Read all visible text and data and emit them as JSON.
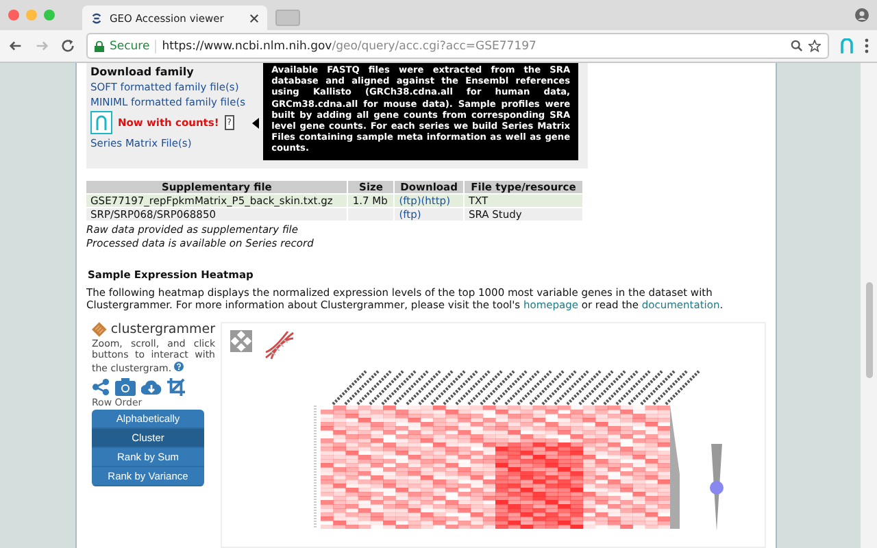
{
  "browser": {
    "tabs": [
      {
        "title": "GEO Accession viewer",
        "selected": true
      }
    ],
    "security": "Secure",
    "url_host": "https://www.ncbi.nlm.nih.gov",
    "url_path": "/geo/query/acc.cgi?acc=GSE77197"
  },
  "download_family": {
    "heading": "Download family",
    "links": [
      "SOFT formatted family file(s)",
      "MINIML formatted family file(s"
    ],
    "badge": "Now with counts!",
    "help": "?",
    "series_matrix": "Series Matrix File(s)",
    "tooltip": "Available FASTQ files were extracted from the SRA database and aligned against the Ensembl references using Kallisto (GRCh38.cdna.all for human data, GRCm38.cdna.all for mouse data). Sample profiles were built by adding all gene counts from corresponding SRA level gene counts. For each series we build Series Matrix Files containing sample meta information as well as gene counts."
  },
  "supplementary": {
    "columns": [
      "Supplementary file",
      "Size",
      "Download",
      "File type/resource"
    ],
    "rows": [
      {
        "file": "GSE77197_repFpkmMatrix_P5_back_skin.txt.gz",
        "size": "1.7 Mb",
        "downloads": [
          "(ftp)",
          "(http)"
        ],
        "type": "TXT"
      },
      {
        "file": "SRP/SRP068/SRP068850",
        "size": "",
        "downloads": [
          "(ftp)"
        ],
        "type": "SRA Study"
      }
    ],
    "notes": [
      "Raw data provided as supplementary file",
      "Processed data is available on Series record"
    ]
  },
  "heatmap_section": {
    "heading": "Sample Expression Heatmap",
    "paragraph": [
      {
        "kind": "text",
        "text": "The following heatmap displays the normalized expression levels of the top 1000 most variable genes in the dataset with Clustergrammer. For more information about Clustergrammer, please visit the tool's "
      },
      {
        "kind": "link",
        "text": "homepage"
      },
      {
        "kind": "text",
        "text": " or read the "
      },
      {
        "kind": "link",
        "text": "documentation"
      },
      {
        "kind": "text",
        "text": "."
      }
    ]
  },
  "clustergrammer": {
    "logo": "clustergrammer",
    "description": "Zoom, scroll, and click buttons to interact with the clustergram.",
    "row_order_label": "Row Order",
    "row_order": [
      {
        "label": "Alphabetically",
        "selected": false
      },
      {
        "label": "Cluster",
        "selected": true
      },
      {
        "label": "Rank by Sum",
        "selected": false
      },
      {
        "label": "Rank by Variance",
        "selected": false
      }
    ],
    "zoom_slider": {
      "level": 0.5
    }
  }
}
